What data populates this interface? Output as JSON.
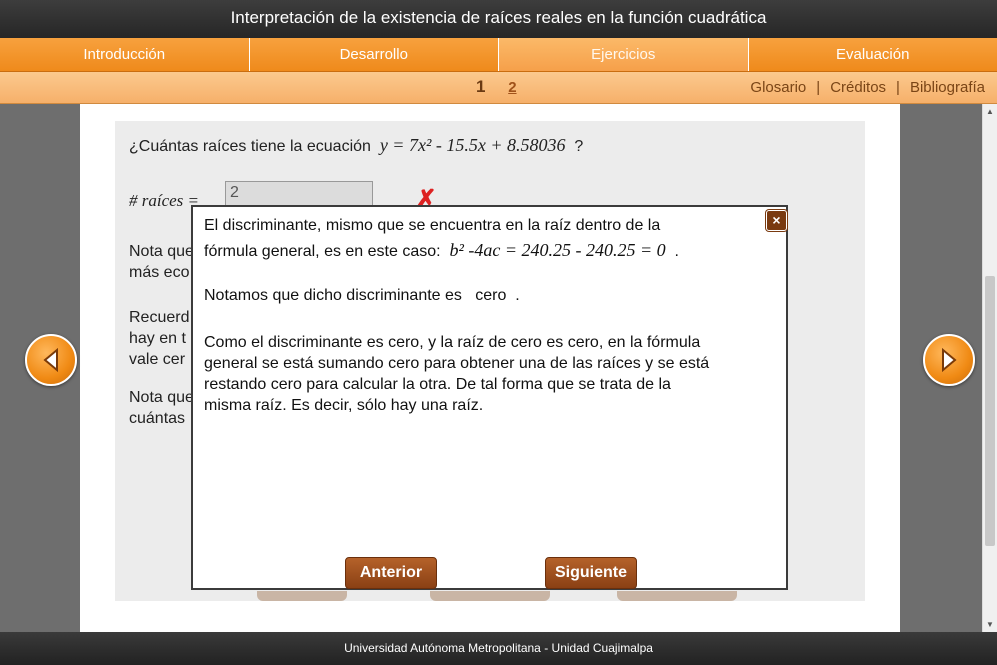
{
  "window": {
    "title": "Interpretación de la existencia de raíces reales en la función cuadrática"
  },
  "nav": {
    "tabs": [
      "Introducción",
      "Desarrollo",
      "Ejercicios",
      "Evaluación"
    ],
    "active": "Ejercicios"
  },
  "pagination": {
    "page1": "1",
    "page2": "2"
  },
  "links": {
    "glosario": "Glosario",
    "creditos": "Créditos",
    "bibliografia": "Bibliografía",
    "separator": "|"
  },
  "exercise": {
    "question_prefix": "¿Cuántas raíces tiene la ecuación",
    "equation": "y = 7x² - 15.5x + 8.58036",
    "question_suffix": "?",
    "roots_label": "# raíces =",
    "roots_value": "2",
    "bg_line1a": "Nota que",
    "bg_line1b": "más eco",
    "bg_line2a": "Recuerd",
    "bg_line2b": "hay en t",
    "bg_line2c": "vale cer",
    "bg_line3a": "Nota que",
    "bg_line3b": "cuántas"
  },
  "modal": {
    "p1_line1": "El discriminante, mismo que se encuentra en la raíz dentro de la",
    "p1_line2_prefix": "fórmula general, es en este caso:",
    "p1_formula": "b² -4ac = 240.25 - 240.25 = 0",
    "p1_line2_suffix": ".",
    "p2_prefix": "Notamos que dicho discriminante es",
    "p2_value": "cero",
    "p2_suffix": ".",
    "p3_line1": "Como el discriminante es cero, y la raíz de cero es cero, en la fórmula",
    "p3_line2": "general se está sumando cero para obtener una de las raíces y se está",
    "p3_line3": "restando cero para calcular la otra. De tal forma que se trata de la",
    "p3_line4": "misma raíz. Es decir, sólo hay una raíz.",
    "close": "×",
    "prev_label": "Anterior",
    "next_label": "Siguiente"
  },
  "footer": {
    "text": "Universidad Autónoma Metropolitana - Unidad Cuajimalpa"
  },
  "colors": {
    "accent": "#f29228",
    "dark_button": "#8a4014",
    "wrong": "#dd2222"
  }
}
